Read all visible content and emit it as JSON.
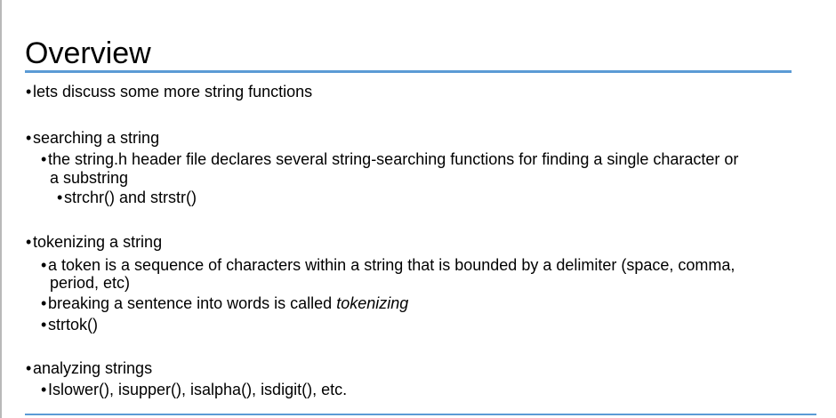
{
  "slide": {
    "title": "Overview",
    "rule_color": "#5b9bd5",
    "bullet_glyph": "•",
    "intro": "lets discuss some more string functions",
    "searching": {
      "heading": "searching a string",
      "detail_line1": "the string.h header file declares several string-searching functions for finding a single character or",
      "detail_line2": "a substring",
      "functions": "strchr() and strstr()"
    },
    "tokenizing": {
      "heading": "tokenizing a string",
      "token_line1": "a token is a sequence of characters within a string that is bounded by a delimiter (space, comma,",
      "token_line2": "period, etc)",
      "breaking_prefix": "breaking a sentence into words is called ",
      "breaking_term": "tokenizing",
      "function": "strtok()"
    },
    "analyzing": {
      "heading": "analyzing strings",
      "functions": "Islower(), isupper(), isalpha(), isdigit(), etc."
    }
  }
}
